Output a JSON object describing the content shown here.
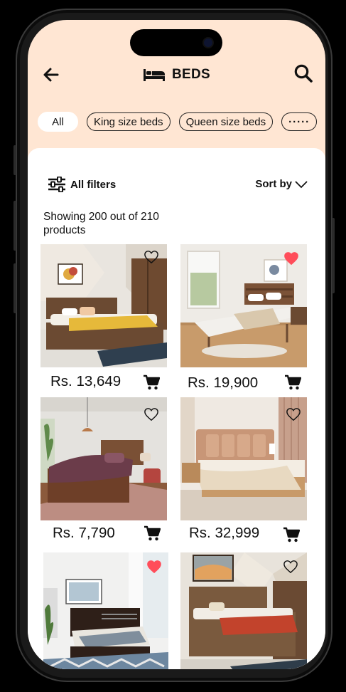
{
  "header": {
    "title": "BEDS",
    "back_icon": "arrow-left-icon",
    "bed_icon": "bed-icon",
    "search_icon": "search-icon"
  },
  "chips": [
    {
      "label": "All",
      "active": true
    },
    {
      "label": "King size beds",
      "active": false
    },
    {
      "label": "Queen size beds",
      "active": false
    },
    {
      "label": "·····",
      "active": false
    }
  ],
  "toolbar": {
    "filters_label": "All filters",
    "sort_label": "Sort by"
  },
  "results_text": "Showing 200 out of 210 products",
  "products": [
    {
      "price": "Rs. 13,649",
      "favorite": false
    },
    {
      "price": "Rs. 19,900",
      "favorite": true
    },
    {
      "price": "Rs. 7,790",
      "favorite": false
    },
    {
      "price": "Rs. 32,999",
      "favorite": false
    },
    {
      "price": "",
      "favorite": true
    },
    {
      "price": "",
      "favorite": false
    }
  ],
  "colors": {
    "header_bg": "#ffe6d3",
    "heart_fill": "#ff4d5a",
    "text": "#111111"
  }
}
